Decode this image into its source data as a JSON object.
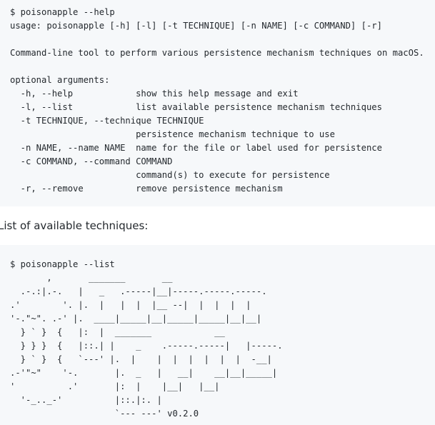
{
  "help_block": {
    "text": "$ poisonapple --help\nusage: poisonapple [-h] [-l] [-t TECHNIQUE] [-n NAME] [-c COMMAND] [-r]\n\nCommand-line tool to perform various persistence mechanism techniques on macOS.\n\noptional arguments:\n  -h, --help            show this help message and exit\n  -l, --list            list available persistence mechanism techniques\n  -t TECHNIQUE, --technique TECHNIQUE\n                        persistence mechanism technique to use\n  -n NAME, --name NAME  name for the file or label used for persistence\n  -c COMMAND, --command COMMAND\n                        command(s) to execute for persistence\n  -r, --remove          remove persistence mechanism"
  },
  "section_heading": "List of available techniques:",
  "list_block": {
    "text": "$ poisonapple --list\n       ,       _______       __\n  .-.:|.-.   |   _   .-----|__|-----.-----.-----.\n.'        '. |.  |   |  |  |__ --|  |  |  |  |\n'-.\"~\". .-' |.  ____|_____|__|_____|_____|__|__|\n  } ` }  {   |:  |  _______            __\n  } } }  {   |::.| |    _    .-----.-----|   |-----.\n  } ` }  {   `---' |.  |    |  |  |  |  |  |  -__|\n.-'\"~\"    '-.       |.  _   |   __|    __|__|_____|\n'          .'       |:  |    |__|   |__|\n  '-_.._-'          |::.|:. |\n                    `--- ---' v0.2.0"
  }
}
